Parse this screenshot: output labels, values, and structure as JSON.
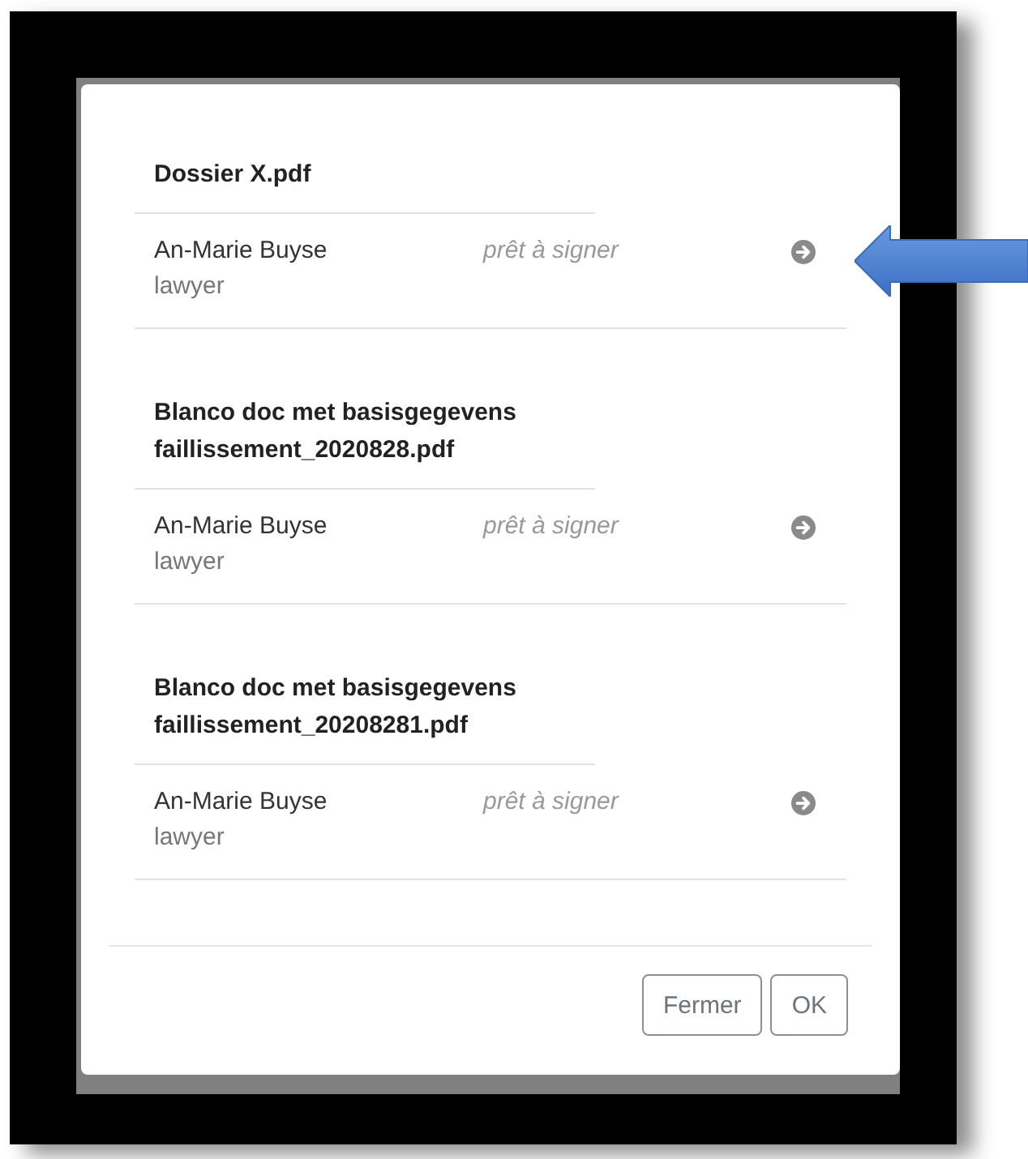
{
  "documents": [
    {
      "title": "Dossier X.pdf",
      "signers": [
        {
          "name": "An-Marie Buyse",
          "role": "lawyer",
          "status": "prêt à signer"
        }
      ]
    },
    {
      "title": "Blanco doc met basisgegevens faillissement_2020828.pdf",
      "signers": [
        {
          "name": "An-Marie Buyse",
          "role": "lawyer",
          "status": "prêt à signer"
        }
      ]
    },
    {
      "title": "Blanco doc met basisgegevens faillissement_20208281.pdf",
      "signers": [
        {
          "name": "An-Marie Buyse",
          "role": "lawyer",
          "status": "prêt à signer"
        }
      ]
    }
  ],
  "buttons": [
    "Fermer",
    "OK"
  ]
}
